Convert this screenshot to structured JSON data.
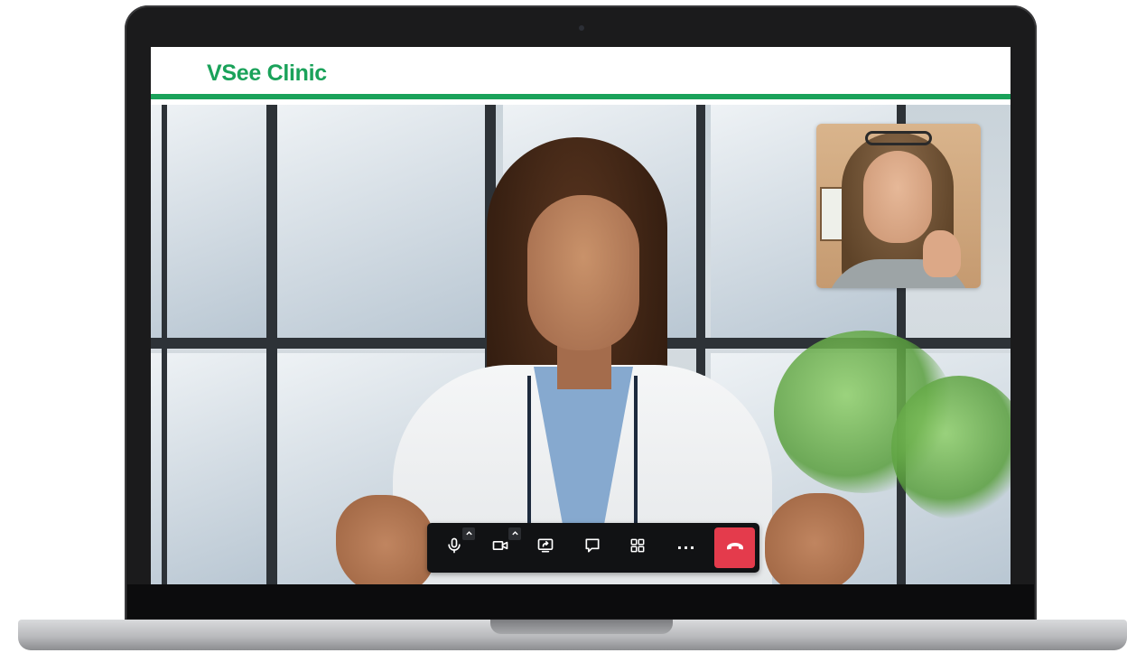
{
  "app": {
    "brand": "VSee Clinic",
    "brand_color": "#1aa25a"
  },
  "video": {
    "main_participant": "doctor-video",
    "self_view": "patient-self-view"
  },
  "controls": {
    "items": [
      {
        "name": "microphone-button",
        "icon": "microphone-icon",
        "has_menu": true
      },
      {
        "name": "camera-button",
        "icon": "video-camera-icon",
        "has_menu": true
      },
      {
        "name": "screen-share-button",
        "icon": "screen-share-icon",
        "has_menu": false
      },
      {
        "name": "chat-button",
        "icon": "chat-icon",
        "has_menu": false
      },
      {
        "name": "layout-button",
        "icon": "grid-icon",
        "has_menu": false
      },
      {
        "name": "more-button",
        "icon": "more-dots-icon",
        "has_menu": false
      },
      {
        "name": "end-call-button",
        "icon": "hang-up-icon",
        "has_menu": false
      }
    ],
    "more_label": "···",
    "end_call_color": "#e43b4c",
    "bar_color": "#111214"
  }
}
